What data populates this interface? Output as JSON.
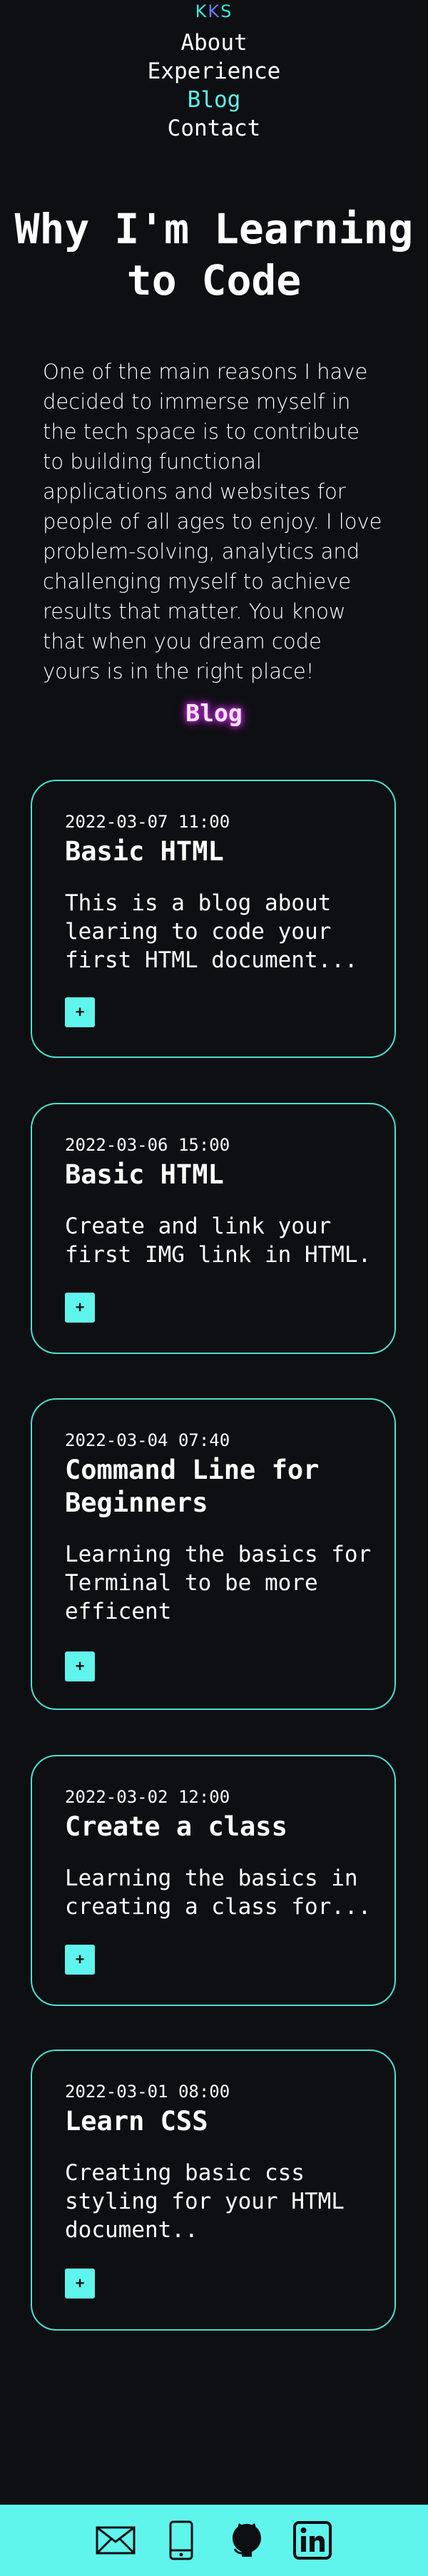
{
  "logo": {
    "left": "K",
    "mid": "K",
    "right": "S"
  },
  "nav": {
    "items": [
      {
        "label": "About"
      },
      {
        "label": "Experience"
      },
      {
        "label": "Blog"
      },
      {
        "label": "Contact"
      }
    ],
    "active": "Blog"
  },
  "hero": {
    "title": "Why I'm Learning to Code",
    "text": "One of the main reasons I have decided to immerse myself in the tech space is to contribute to building functional applications and websites for people of all ages to enjoy. I love problem-solving, analytics and challenging myself to achieve results that matter. You know that when you dream code yours is in the right place!"
  },
  "blog": {
    "heading": "Blog",
    "posts": [
      {
        "date": "2022-03-07 11:00",
        "title": "Basic HTML",
        "desc": "This is a blog about learing to code your first HTML document...",
        "button": "+"
      },
      {
        "date": "2022-03-06 15:00",
        "title": "Basic HTML",
        "desc": "Create and link your first IMG link in HTML.",
        "button": "+"
      },
      {
        "date": "2022-03-04 07:40",
        "title": "Command Line for Beginners",
        "desc": "Learning the basics for Terminal to be more efficent",
        "button": "+"
      },
      {
        "date": "2022-03-02 12:00",
        "title": "Create a class",
        "desc": "Learning the basics in creating a class for...",
        "button": "+"
      },
      {
        "date": "2022-03-01 08:00",
        "title": "Learn CSS",
        "desc": "Creating basic css styling for your HTML document..",
        "button": "+"
      }
    ]
  },
  "footer": {
    "icons": [
      "email-icon",
      "phone-icon",
      "github-icon",
      "linkedin-icon"
    ]
  },
  "colors": {
    "background": "#0d0f12",
    "accent": "#5ff5ec",
    "card_border": "#4ddfd3",
    "blog_glow": "#e83cff"
  }
}
